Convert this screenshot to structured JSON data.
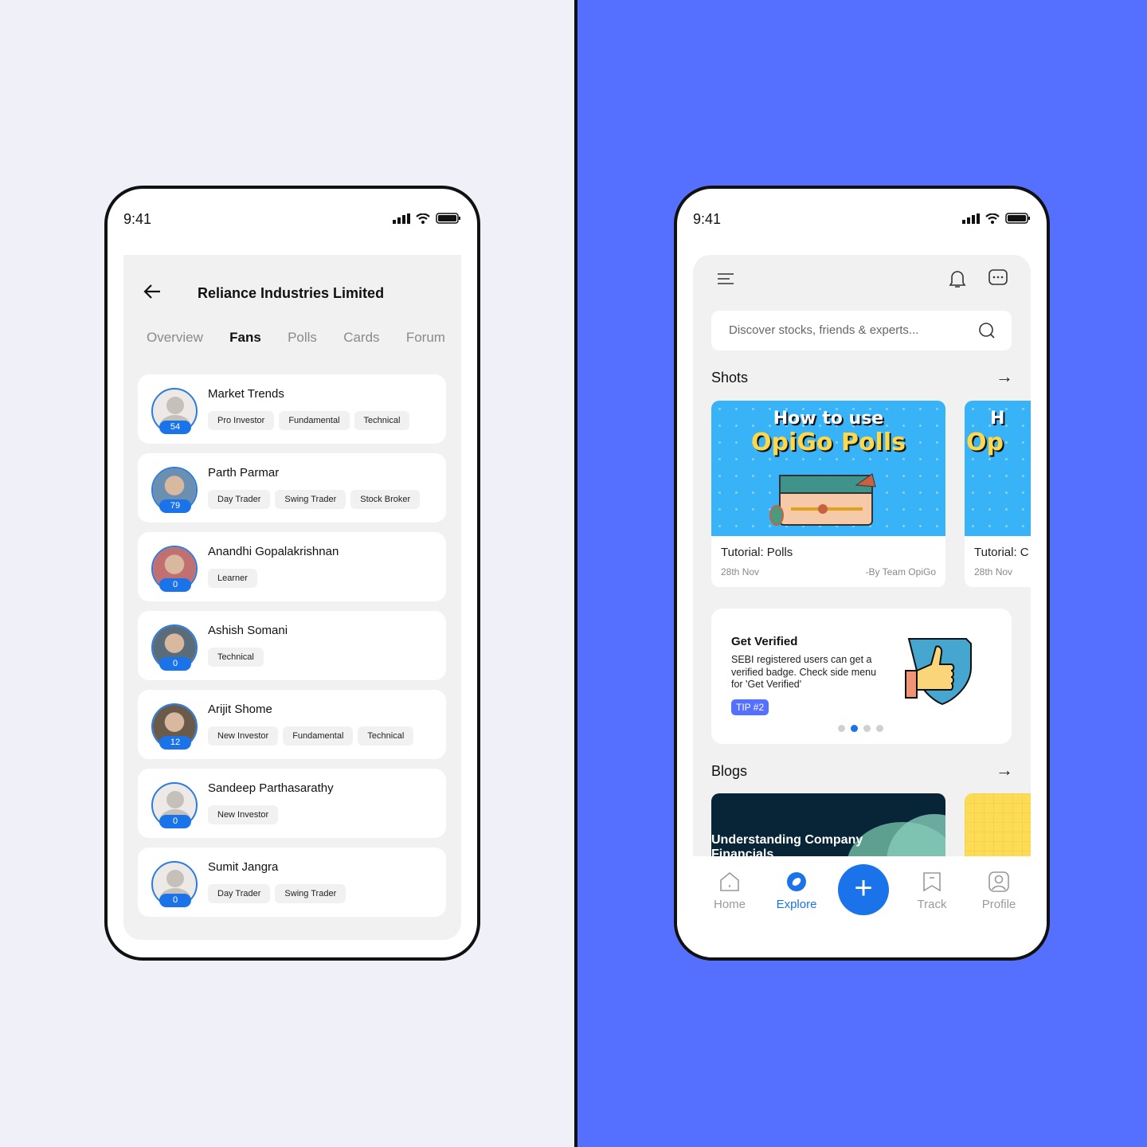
{
  "status_time": "9:41",
  "left": {
    "title": "Reliance Industries Limited",
    "tabs": [
      "Overview",
      "Fans",
      "Polls",
      "Cards",
      "Forum"
    ],
    "active_tab": "Fans",
    "fans": [
      {
        "name": "Market Trends",
        "count": "54",
        "tags": [
          "Pro Investor",
          "Fundamental",
          "Technical"
        ]
      },
      {
        "name": "Parth Parmar",
        "count": "79",
        "tags": [
          "Day Trader",
          "Swing Trader",
          "Stock Broker"
        ]
      },
      {
        "name": "Anandhi Gopalakrishnan",
        "count": "0",
        "tags": [
          "Learner"
        ]
      },
      {
        "name": "Ashish Somani",
        "count": "0",
        "tags": [
          "Technical"
        ]
      },
      {
        "name": "Arijit Shome",
        "count": "12",
        "tags": [
          "New Investor",
          "Fundamental",
          "Technical"
        ]
      },
      {
        "name": "Sandeep Parthasarathy",
        "count": "0",
        "tags": [
          "New Investor"
        ]
      },
      {
        "name": "Sumit Jangra",
        "count": "0",
        "tags": [
          "Day Trader",
          "Swing Trader"
        ]
      }
    ]
  },
  "right": {
    "search_placeholder": "Discover stocks, friends & experts...",
    "shots_title": "Shots",
    "shots": [
      {
        "img_line1": "How to use",
        "img_line2": "OpiGo Polls",
        "title": "Tutorial: Polls",
        "date": "28th Nov",
        "author": "-By Team OpiGo"
      },
      {
        "img_line1": "H",
        "img_line2": "Op",
        "title": "Tutorial: C",
        "date": "28th Nov"
      }
    ],
    "tip": {
      "title": "Get Verified",
      "body": "SEBI registered users can get a verified badge. Check side menu for 'Get Verified'",
      "badge": "TIP #2",
      "active_dot": 2,
      "dots": 4
    },
    "blogs_title": "Blogs",
    "blog": {
      "title": "Understanding Company Financials"
    },
    "nav": [
      {
        "label": "Home"
      },
      {
        "label": "Explore",
        "active": true
      },
      {
        "label": "Track"
      },
      {
        "label": "Profile"
      }
    ],
    "accent": "#1a73e8",
    "background": "#5570ff"
  }
}
